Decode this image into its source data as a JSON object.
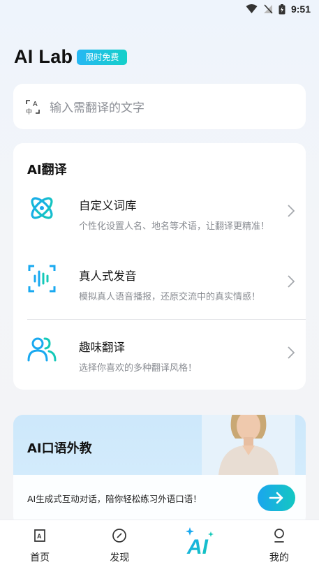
{
  "status": {
    "time": "9:51"
  },
  "header": {
    "title": "AI Lab",
    "badge": "限时免费"
  },
  "search": {
    "placeholder": "输入需翻译的文字"
  },
  "translate": {
    "title": "AI翻译",
    "features": [
      {
        "title": "自定义词库",
        "subtitle": "个性化设置人名、地名等术语，让翻译更精准！",
        "icon": "atom-icon"
      },
      {
        "title": "真人式发音",
        "subtitle": "模拟真人语音播报，还原交流中的真实情感！",
        "icon": "voice-wave-icon"
      },
      {
        "title": "趣味翻译",
        "subtitle": "选择你喜欢的多种翻译风格！",
        "icon": "people-icon"
      }
    ]
  },
  "tutor": {
    "title": "AI口语外教",
    "description": "AI生成式互动对话，陪你轻松练习外语口语！"
  },
  "tabs": [
    {
      "label": "首页",
      "icon": "home-icon"
    },
    {
      "label": "发现",
      "icon": "compass-icon"
    },
    {
      "label": "",
      "icon": "ai-icon"
    },
    {
      "label": "我的",
      "icon": "profile-icon"
    }
  ],
  "colors": {
    "accent": "#1aa6ee",
    "teal": "#14c7c2"
  }
}
